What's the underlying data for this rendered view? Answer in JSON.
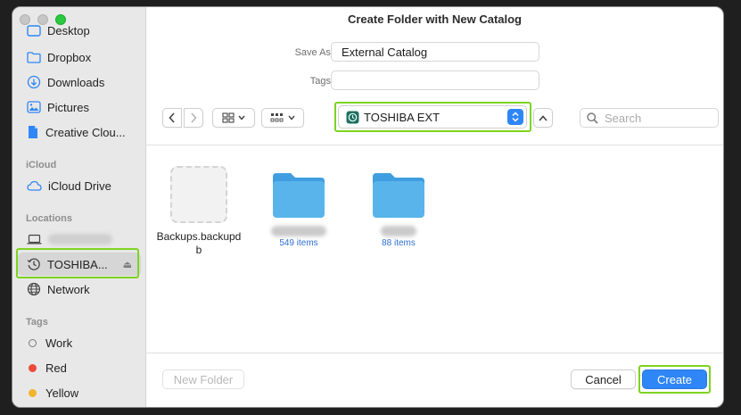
{
  "window": {
    "title": "Create Folder with New Catalog"
  },
  "sidebar": {
    "favorites": [
      {
        "label": "Desktop",
        "icon": "desktop-icon"
      },
      {
        "label": "Dropbox",
        "icon": "dropbox-folder-icon"
      },
      {
        "label": "Downloads",
        "icon": "downloads-icon"
      },
      {
        "label": "Pictures",
        "icon": "pictures-icon"
      },
      {
        "label": "Creative Clou...",
        "icon": "document-icon"
      }
    ],
    "icloud_header": "iCloud",
    "icloud_items": [
      {
        "label": "iCloud Drive",
        "icon": "cloud-icon"
      }
    ],
    "locations_header": "Locations",
    "locations": [
      {
        "label": "",
        "icon": "laptop-icon"
      },
      {
        "label": "TOSHIBA...",
        "icon": "time-machine-icon",
        "selected": true,
        "eject": "⏏"
      },
      {
        "label": "Network",
        "icon": "globe-icon"
      }
    ],
    "tags_header": "Tags",
    "tags": [
      {
        "label": "Work",
        "color": ""
      },
      {
        "label": "Red",
        "color": "#ec4a3d"
      },
      {
        "label": "Yellow",
        "color": "#f0b62a"
      }
    ]
  },
  "form": {
    "save_as_label": "Save As:",
    "save_as_value": "External Catalog",
    "tags_label": "Tags:",
    "tags_value": ""
  },
  "toolbar": {
    "location": "TOSHIBA EXT",
    "search_placeholder": "Search"
  },
  "files": [
    {
      "name": "Backups.backupdb",
      "type": "package",
      "count": ""
    },
    {
      "name": "",
      "type": "folder",
      "count": "549 items"
    },
    {
      "name": "",
      "type": "folder",
      "count": "88 items"
    }
  ],
  "buttons": {
    "new_folder": "New Folder",
    "cancel": "Cancel",
    "create": "Create"
  },
  "colors": {
    "accent": "#2f86f6",
    "highlight": "#7ed321",
    "folder": "#5ab4ec"
  }
}
